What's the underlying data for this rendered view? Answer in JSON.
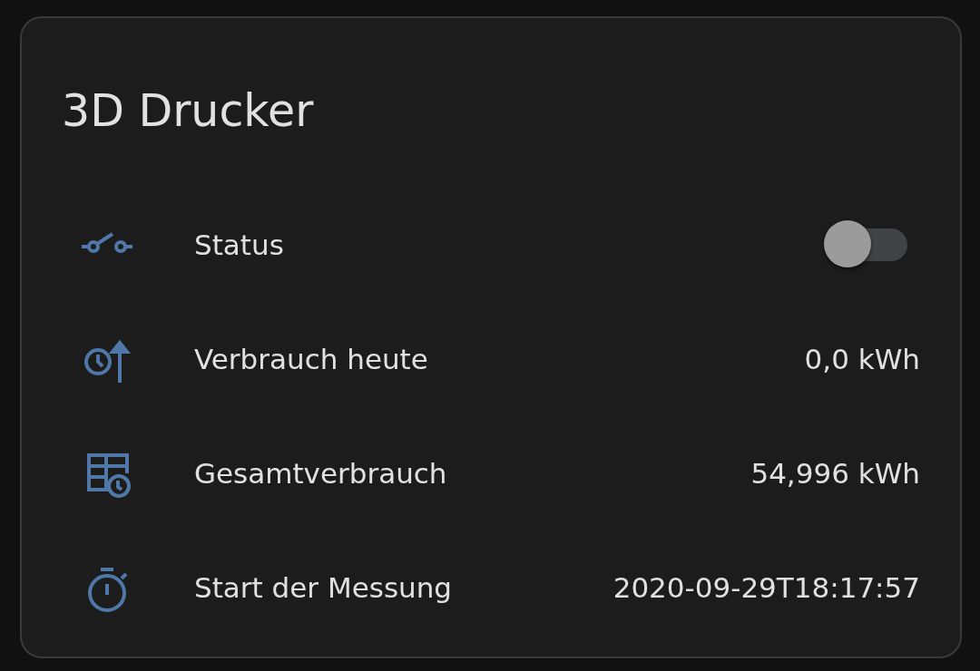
{
  "card": {
    "title": "3D Drucker",
    "rows": [
      {
        "kind": "toggle",
        "label": "Status",
        "on": false
      },
      {
        "kind": "value",
        "label": "Verbrauch heute",
        "value": "0,0 kWh"
      },
      {
        "kind": "value",
        "label": "Gesamtverbrauch",
        "value": "54,996 kWh"
      },
      {
        "kind": "value",
        "label": "Start der Messung",
        "value": "2020-09-29T18:17:57"
      }
    ]
  }
}
